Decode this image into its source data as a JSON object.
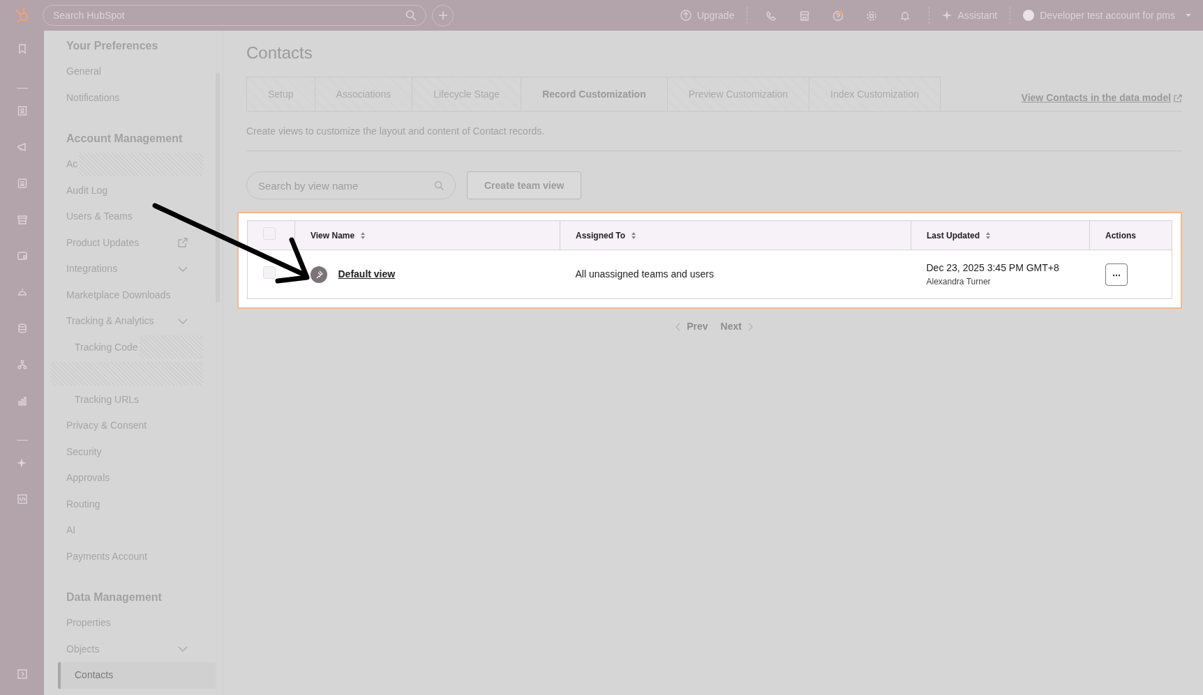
{
  "topbar": {
    "search": {
      "placeholder": "Search HubSpot"
    },
    "upgrade": "Upgrade",
    "assistant": "Assistant",
    "account": "Developer test account for pms"
  },
  "sidebar": {
    "sections": [
      {
        "heading": "Your Preferences",
        "items": [
          {
            "label": "General",
            "selected": false
          },
          {
            "label": "Notifications",
            "selected": false
          }
        ]
      },
      {
        "heading": "Account Management",
        "items": [
          {
            "label": "Ac",
            "selected": false,
            "redacted": true
          },
          {
            "label": "Audit Log",
            "selected": false
          },
          {
            "label": "Users & Teams",
            "selected": false
          },
          {
            "label": "Product Updates",
            "kind": "external",
            "selected": false
          },
          {
            "label": "Integrations",
            "kind": "group",
            "selected": false
          },
          {
            "label": "Marketplace Downloads",
            "selected": false
          },
          {
            "label": "Tracking & Analytics",
            "kind": "group",
            "selected": false,
            "children": [
              {
                "label": "Tracking Code",
                "selected": false,
                "redacted": true
              },
              {
                "selected": false,
                "redacted": true
              },
              {
                "label": "Tracking URLs",
                "selected": false
              }
            ]
          },
          {
            "label": "Privacy & Consent",
            "selected": false
          },
          {
            "label": "Security",
            "selected": false
          },
          {
            "label": "Approvals",
            "selected": false
          },
          {
            "label": "Routing",
            "selected": false
          },
          {
            "label": "AI",
            "selected": false
          },
          {
            "label": "Payments Account",
            "selected": false
          }
        ]
      },
      {
        "heading": "Data Management",
        "items": [
          {
            "label": "Properties",
            "selected": false
          },
          {
            "label": "Objects",
            "kind": "group",
            "selected": false,
            "children": [
              {
                "label": "Contacts",
                "selected": true
              }
            ]
          }
        ]
      }
    ]
  },
  "page": {
    "title": "Contacts",
    "tabs": [
      {
        "label": "Setup",
        "selected": false
      },
      {
        "label": "Associations",
        "selected": false
      },
      {
        "label": "Lifecycle Stage",
        "selected": false
      },
      {
        "label": "Record Customization",
        "selected": true
      },
      {
        "label": "Preview Customization",
        "selected": false
      },
      {
        "label": "Index Customization",
        "selected": false
      }
    ],
    "data_model_link": "View Contacts in the data model",
    "description": "Create views to customize the layout and content of Contact records.",
    "search": {
      "placeholder": "Search by view name"
    },
    "create_button": "Create team view",
    "table": {
      "select_all": {
        "checked": false
      },
      "columns": [
        {
          "label": "View Name",
          "sortable": true
        },
        {
          "label": "Assigned To",
          "sortable": true
        },
        {
          "label": "Last Updated",
          "sortable": true
        },
        {
          "label": "Actions"
        }
      ],
      "rows": [
        {
          "checked": false,
          "pinned": true,
          "name": "Default view",
          "assigned_to": "All unassigned teams and users",
          "updated": "Dec 23, 2025 3:45 PM GMT+8",
          "updated_by": "Alexandra Turner"
        }
      ]
    },
    "pagination": {
      "prev": "Prev",
      "next": "Next"
    }
  }
}
